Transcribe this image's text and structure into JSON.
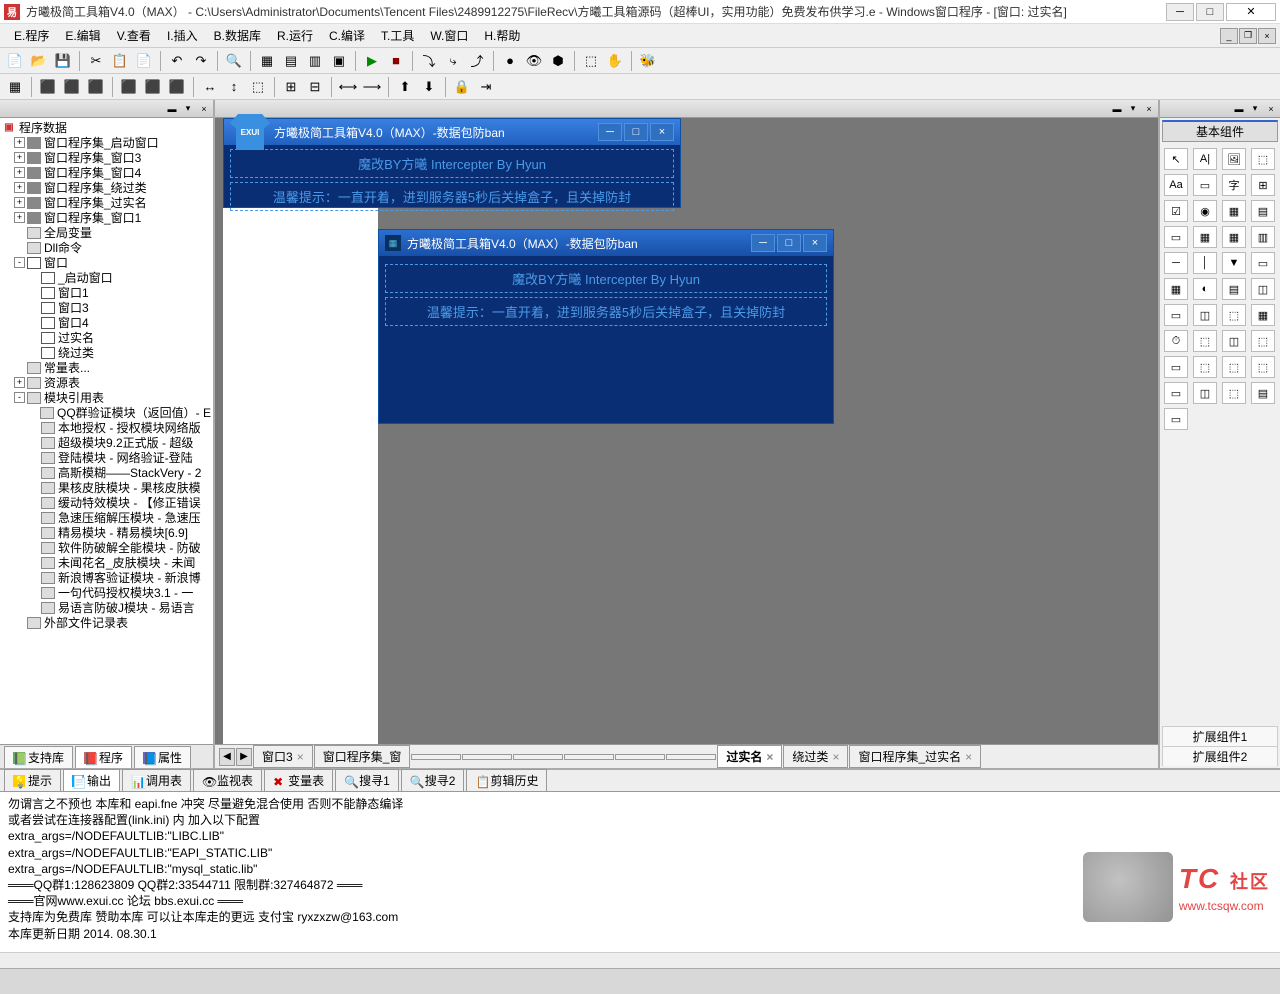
{
  "titlebar": {
    "app_icon": "易",
    "title": "方曦极简工具箱V4.0（MAX）  -  C:\\Users\\Administrator\\Documents\\Tencent Files\\2489912275\\FileRecv\\方曦工具箱源码（超棒UI，实用功能）免费发布供学习.e - Windows窗口程序 - [窗口: 过实名]"
  },
  "menus": {
    "program": "E.程序",
    "edit": "E.编辑",
    "view": "V.查看",
    "insert": "I.插入",
    "database": "B.数据库",
    "run": "R.运行",
    "compile": "C.编译",
    "tools": "T.工具",
    "window": "W.窗口",
    "help": "H.帮助"
  },
  "left_tree": {
    "root": "程序数据",
    "items": [
      {
        "exp": "+",
        "icon": "folder",
        "label": "窗口程序集_启动窗口",
        "ind": 1
      },
      {
        "exp": "+",
        "icon": "folder",
        "label": "窗口程序集_窗口3",
        "ind": 1
      },
      {
        "exp": "+",
        "icon": "folder",
        "label": "窗口程序集_窗口4",
        "ind": 1
      },
      {
        "exp": "+",
        "icon": "folder",
        "label": "窗口程序集_绕过类",
        "ind": 1
      },
      {
        "exp": "+",
        "icon": "folder",
        "label": "窗口程序集_过实名",
        "ind": 1
      },
      {
        "exp": "+",
        "icon": "folder",
        "label": "窗口程序集_窗口1",
        "ind": 1
      },
      {
        "exp": "",
        "icon": "mod",
        "label": "全局变量",
        "ind": 1
      },
      {
        "exp": "",
        "icon": "mod",
        "label": "Dll命令",
        "ind": 1
      },
      {
        "exp": "-",
        "icon": "win",
        "label": "窗口",
        "ind": 1
      },
      {
        "exp": "",
        "icon": "win",
        "label": "_启动窗口",
        "ind": 2
      },
      {
        "exp": "",
        "icon": "win",
        "label": "窗口1",
        "ind": 2
      },
      {
        "exp": "",
        "icon": "win",
        "label": "窗口3",
        "ind": 2
      },
      {
        "exp": "",
        "icon": "win",
        "label": "窗口4",
        "ind": 2
      },
      {
        "exp": "",
        "icon": "win",
        "label": "过实名",
        "ind": 2
      },
      {
        "exp": "",
        "icon": "win",
        "label": "绕过类",
        "ind": 2
      },
      {
        "exp": "",
        "icon": "mod",
        "label": "常量表...",
        "ind": 1
      },
      {
        "exp": "+",
        "icon": "mod",
        "label": "资源表",
        "ind": 1
      },
      {
        "exp": "-",
        "icon": "mod",
        "label": "模块引用表",
        "ind": 1
      },
      {
        "exp": "",
        "icon": "mod",
        "label": "QQ群验证模块（返回值）- E",
        "ind": 2
      },
      {
        "exp": "",
        "icon": "mod",
        "label": "本地授权 - 授权模块网络版",
        "ind": 2
      },
      {
        "exp": "",
        "icon": "mod",
        "label": "超级模块9.2正式版 - 超级",
        "ind": 2
      },
      {
        "exp": "",
        "icon": "mod",
        "label": "登陆模块 - 网络验证-登陆",
        "ind": 2
      },
      {
        "exp": "",
        "icon": "mod",
        "label": "高斯模糊——StackVery - 2",
        "ind": 2
      },
      {
        "exp": "",
        "icon": "mod",
        "label": "果核皮肤模块 - 果核皮肤模",
        "ind": 2
      },
      {
        "exp": "",
        "icon": "mod",
        "label": "缓动特效模块 - 【修正错误",
        "ind": 2
      },
      {
        "exp": "",
        "icon": "mod",
        "label": "急速压缩解压模块 - 急速压",
        "ind": 2
      },
      {
        "exp": "",
        "icon": "mod",
        "label": "精易模块 - 精易模块[6.9]",
        "ind": 2
      },
      {
        "exp": "",
        "icon": "mod",
        "label": "软件防破解全能模块 - 防破",
        "ind": 2
      },
      {
        "exp": "",
        "icon": "mod",
        "label": "未闻花名_皮肤模块 - 未闻",
        "ind": 2
      },
      {
        "exp": "",
        "icon": "mod",
        "label": "新浪博客验证模块 - 新浪博",
        "ind": 2
      },
      {
        "exp": "",
        "icon": "mod",
        "label": "一句代码授权模块3.1 - 一",
        "ind": 2
      },
      {
        "exp": "",
        "icon": "mod",
        "label": "易语言防破J模块 - 易语言",
        "ind": 2
      },
      {
        "exp": "",
        "icon": "mod",
        "label": "外部文件记录表",
        "ind": 1
      }
    ]
  },
  "left_tabs": {
    "support": "支持库",
    "program": "程序",
    "props": "属性"
  },
  "form1": {
    "title": "方曦极简工具箱V4.0（MAX）-数据包防ban",
    "line1": "魔改BY方曦   Intercepter By Hyun",
    "line2": "温馨提示：一直开着，进到服务器5秒后关掉盒子，且关掉防封",
    "tshirt": "EXUI"
  },
  "form2": {
    "title": "方曦极简工具箱V4.0（MAX）-数据包防ban",
    "line1": "魔改BY方曦   Intercepter By Hyun",
    "line2": "温馨提示：一直开着，进到服务器5秒后关掉盒子，且关掉防封"
  },
  "center_tabs": {
    "t1": "窗口3",
    "t2": "窗口程序集_窗",
    "t3": "",
    "t4": "",
    "t5": "",
    "t6": "",
    "t7": "",
    "t8": "",
    "active": "过实名",
    "t9": "绕过类",
    "t10": "窗口程序集_过实名"
  },
  "right": {
    "header": "基本组件",
    "ext1": "扩展组件1",
    "ext2": "扩展组件2"
  },
  "bottom_tabs": {
    "tips": "提示",
    "output": "输出",
    "calls": "调用表",
    "watch": "监视表",
    "vars": "变量表",
    "find1": "搜寻1",
    "find2": "搜寻2",
    "clip": "剪辑历史"
  },
  "output": {
    "l1": "勿谓言之不预也 本库和 eapi.fne 冲突 尽量避免混合使用 否则不能静态编译",
    "l2": "或者尝试在连接器配置(link.ini) 内 加入以下配置",
    "l3": "extra_args=/NODEFAULTLIB:\"LIBC.LIB\"",
    "l4": "extra_args=/NODEFAULTLIB:\"EAPI_STATIC.LIB\"",
    "l5": "extra_args=/NODEFAULTLIB:\"mysql_static.lib\"",
    "l6": "═══QQ群1:128623809 QQ群2:33544711 限制群:327464872 ═══",
    "l7": "═══官网www.exui.cc  论坛 bbs.exui.cc ═══",
    "l8": "支持库为免费库 赞助本库 可以让本库走的更远 支付宝 ryxzxzw@163.com",
    "l9": "本库更新日期 2014. 08.30.1"
  },
  "watermark": {
    "brand": "TC",
    "suffix": "社区",
    "url": "www.tcsqw.com"
  }
}
